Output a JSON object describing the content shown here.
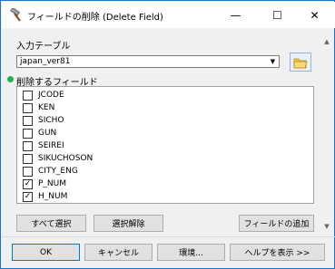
{
  "window": {
    "title": "フィールドの削除 (Delete Field)",
    "controls": {
      "minimize": "—",
      "maximize": "☐",
      "close": "✕"
    }
  },
  "input_table": {
    "label": "入力テーブル",
    "value": "japan_ver81"
  },
  "fields_section": {
    "label": "削除するフィールド",
    "items": [
      {
        "label": "JCODE",
        "checked": false
      },
      {
        "label": "KEN",
        "checked": false
      },
      {
        "label": "SICHO",
        "checked": false
      },
      {
        "label": "GUN",
        "checked": false
      },
      {
        "label": "SEIREI",
        "checked": false
      },
      {
        "label": "SIKUCHOSON",
        "checked": false
      },
      {
        "label": "CITY_ENG",
        "checked": false
      },
      {
        "label": "P_NUM",
        "checked": true
      },
      {
        "label": "H_NUM",
        "checked": true
      }
    ]
  },
  "list_buttons": {
    "select_all": "すべて選択",
    "deselect": "選択解除",
    "add_field": "フィールドの追加"
  },
  "footer_buttons": {
    "ok": "OK",
    "cancel": "キャンセル",
    "environments": "環境...",
    "show_help": "ヘルプを表示 >>"
  },
  "colors": {
    "window_border": "#1a73c7",
    "required_dot": "#22b14c",
    "default_button_border": "#0078d7"
  }
}
